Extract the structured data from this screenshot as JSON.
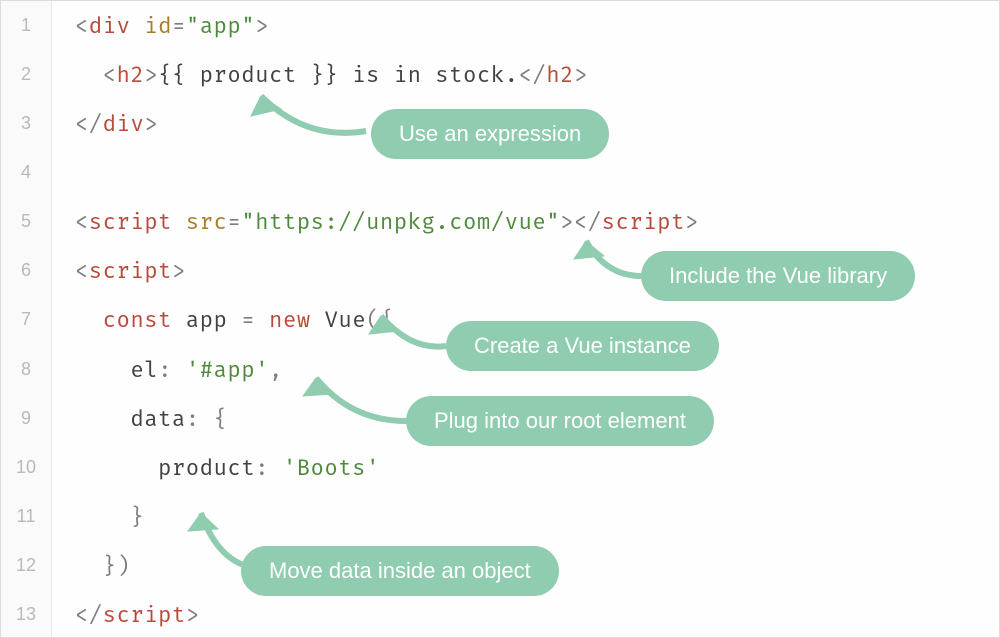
{
  "lines": [
    {
      "num": "1",
      "html": "<span class='p'>&lt;</span><span class='tag'>div</span> <span class='attr'>id</span><span class='p'>=</span><span class='str'>\"app\"</span><span class='p'>&gt;</span>"
    },
    {
      "num": "2",
      "html": "  <span class='p'>&lt;</span><span class='tag'>h2</span><span class='p'>&gt;</span><span class='nm'>{{ product }} is in stock.</span><span class='p'>&lt;/</span><span class='tag'>h2</span><span class='p'>&gt;</span>"
    },
    {
      "num": "3",
      "html": "<span class='p'>&lt;/</span><span class='tag'>div</span><span class='p'>&gt;</span>"
    },
    {
      "num": "4",
      "html": ""
    },
    {
      "num": "5",
      "html": "<span class='p'>&lt;</span><span class='tag'>script</span> <span class='attr'>src</span><span class='p'>=</span><span class='str'>\"https://unpkg.com/vue\"</span><span class='p'>&gt;&lt;/</span><span class='tag'>script</span><span class='p'>&gt;</span>"
    },
    {
      "num": "6",
      "html": "<span class='p'>&lt;</span><span class='tag'>script</span><span class='p'>&gt;</span>"
    },
    {
      "num": "7",
      "html": "  <span class='kw'>const</span> <span class='nm'>app</span> <span class='p'>=</span> <span class='kw'>new</span> <span class='fn'>Vue</span><span class='p'>({</span>"
    },
    {
      "num": "8",
      "html": "    <span class='nm'>el</span><span class='p'>:</span> <span class='str'>'#app'</span><span class='p'>,</span>"
    },
    {
      "num": "9",
      "html": "    <span class='nm'>data</span><span class='p'>: {</span>"
    },
    {
      "num": "10",
      "html": "      <span class='nm'>product</span><span class='p'>:</span> <span class='str'>'Boots'</span>"
    },
    {
      "num": "11",
      "html": "    <span class='p'>}</span>"
    },
    {
      "num": "12",
      "html": "  <span class='p'>})</span>"
    },
    {
      "num": "13",
      "html": "<span class='p'>&lt;/</span><span class='tag'>script</span><span class='p'>&gt;</span>"
    }
  ],
  "annotations": {
    "expression": "Use an expression",
    "include_vue": "Include the Vue library",
    "create_instance": "Create a Vue instance",
    "plug_root": "Plug into our root element",
    "move_data": "Move data inside an object"
  }
}
